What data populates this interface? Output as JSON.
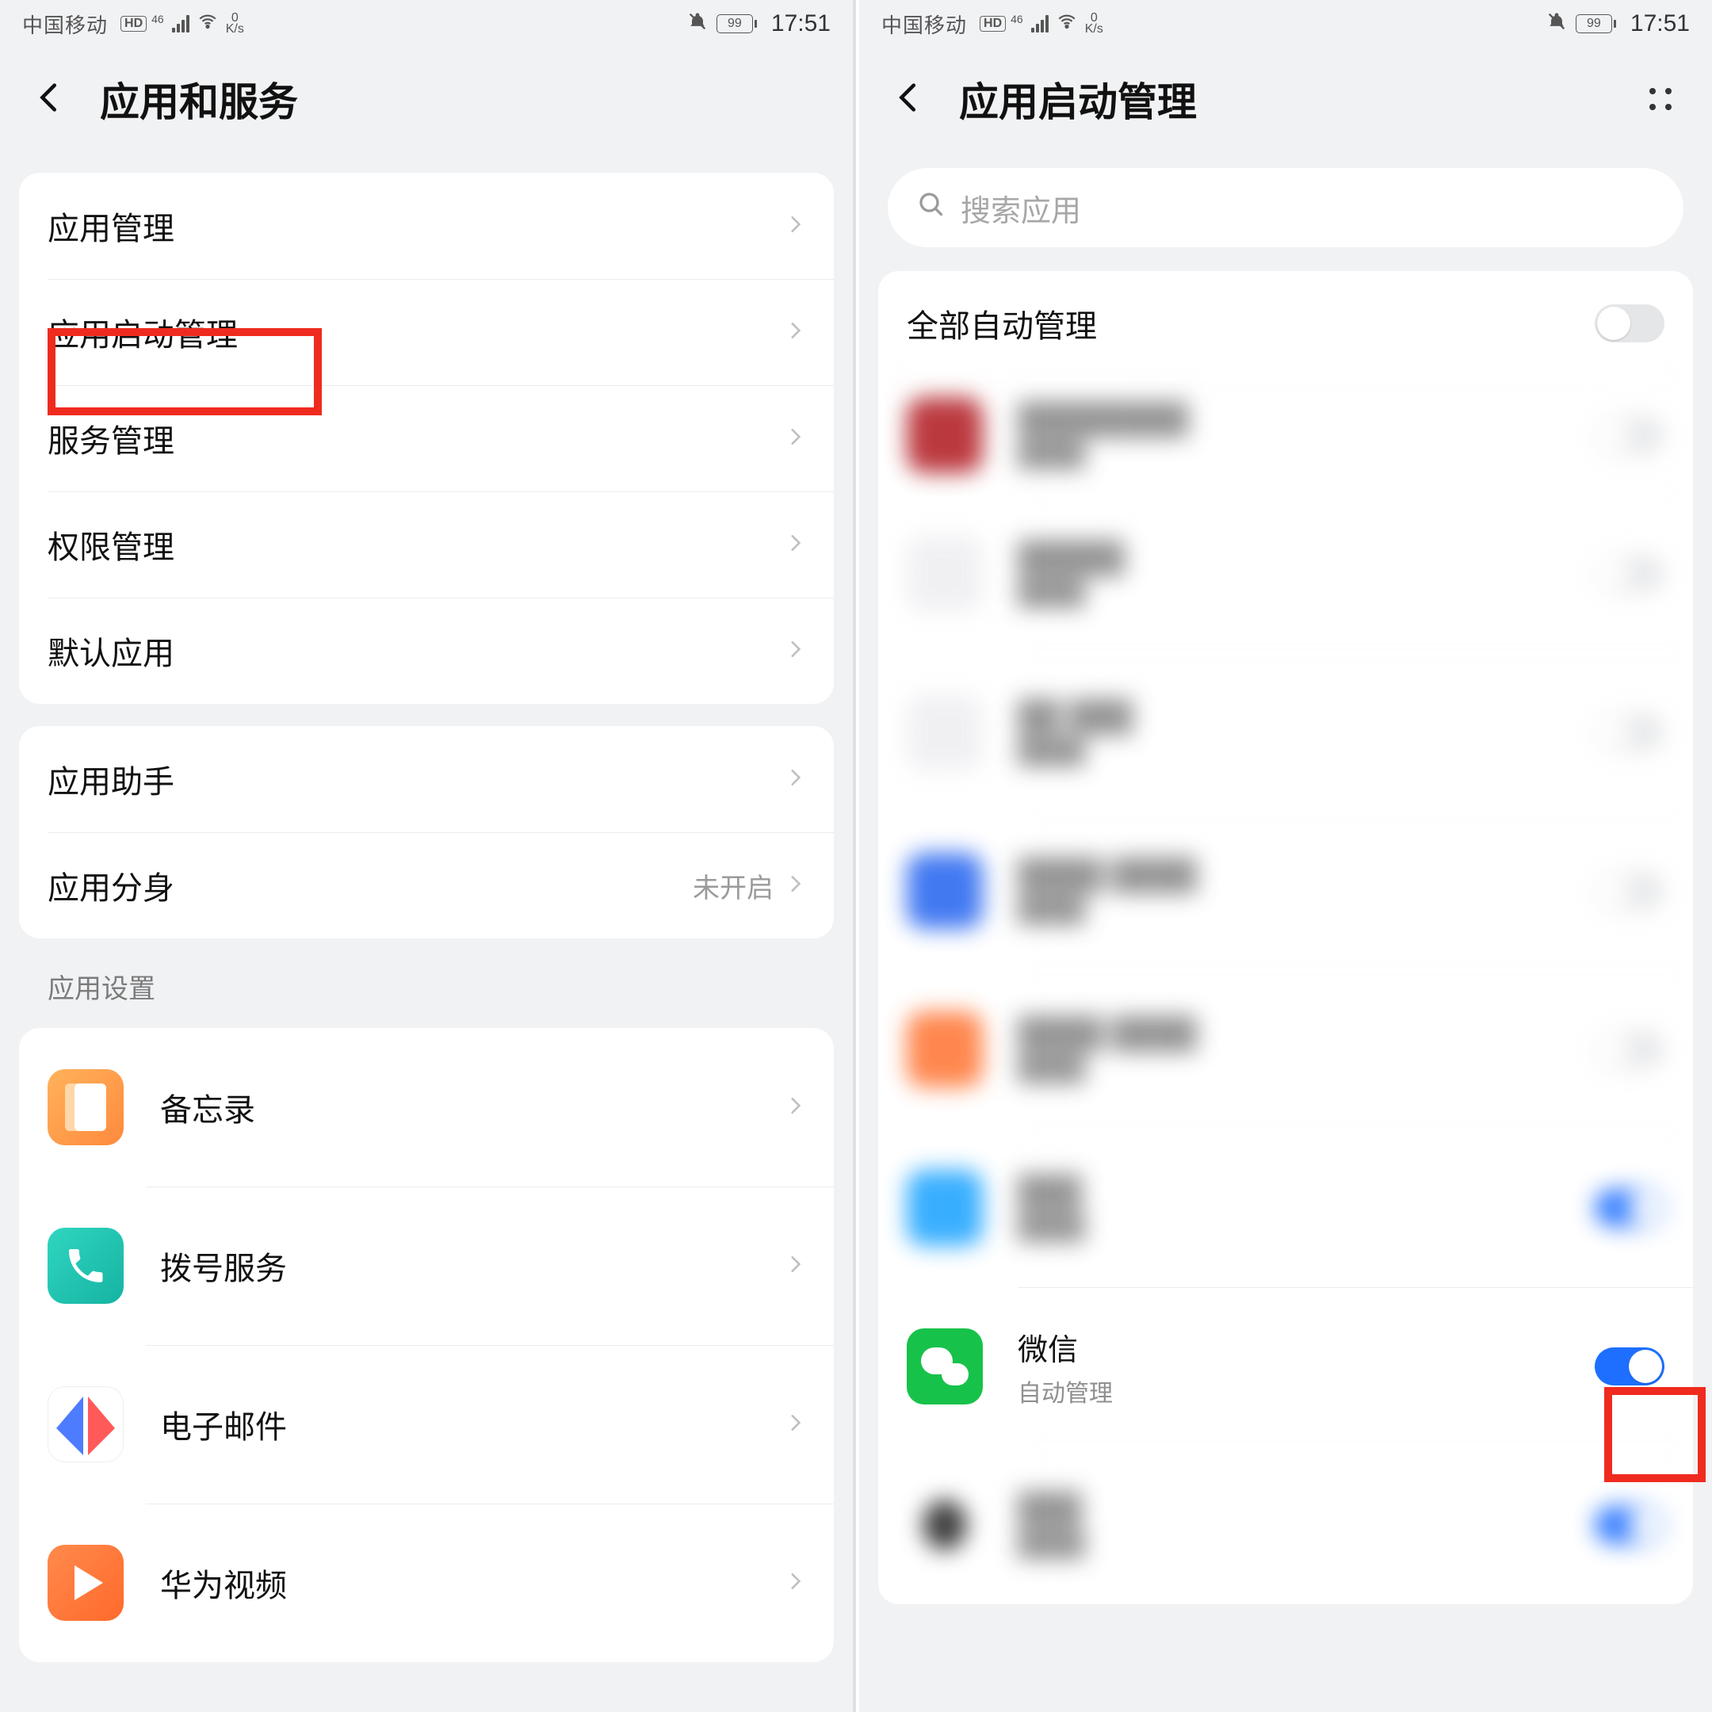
{
  "status": {
    "carrier": "中国移动",
    "hd": "HD",
    "net_sup": "46",
    "speed_top": "0",
    "speed_bottom": "K/s",
    "battery": "99",
    "time": "17:51"
  },
  "left": {
    "title": "应用和服务",
    "group1": [
      {
        "label": "应用管理"
      },
      {
        "label": "应用启动管理"
      },
      {
        "label": "服务管理"
      },
      {
        "label": "权限管理"
      },
      {
        "label": "默认应用"
      }
    ],
    "group2": [
      {
        "label": "应用助手",
        "value": ""
      },
      {
        "label": "应用分身",
        "value": "未开启"
      }
    ],
    "section_header": "应用设置",
    "apps": [
      {
        "label": "备忘录"
      },
      {
        "label": "拨号服务"
      },
      {
        "label": "电子邮件"
      },
      {
        "label": "华为视频"
      }
    ]
  },
  "right": {
    "title": "应用启动管理",
    "search_placeholder": "搜索应用",
    "head_label": "全部自动管理",
    "wechat_name": "微信",
    "wechat_sub": "自动管理"
  }
}
